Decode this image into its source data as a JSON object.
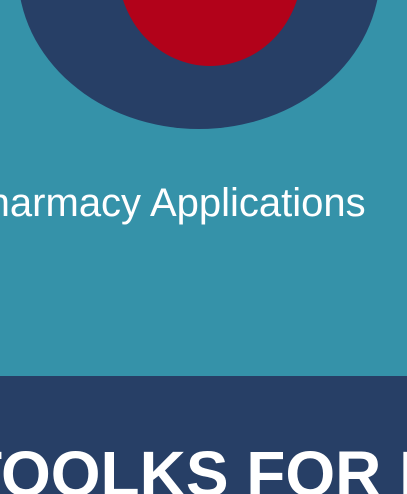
{
  "hero": {
    "subtitle": "Pharmacy Applications",
    "background_color": "#3592a9",
    "logo": {
      "icon": "target-logo-icon",
      "outer_color": "#273f66",
      "inner_color": "#b2021a"
    }
  },
  "banner": {
    "heading": "TOOLKS FOR HEALTH",
    "background_color": "#273f66"
  }
}
